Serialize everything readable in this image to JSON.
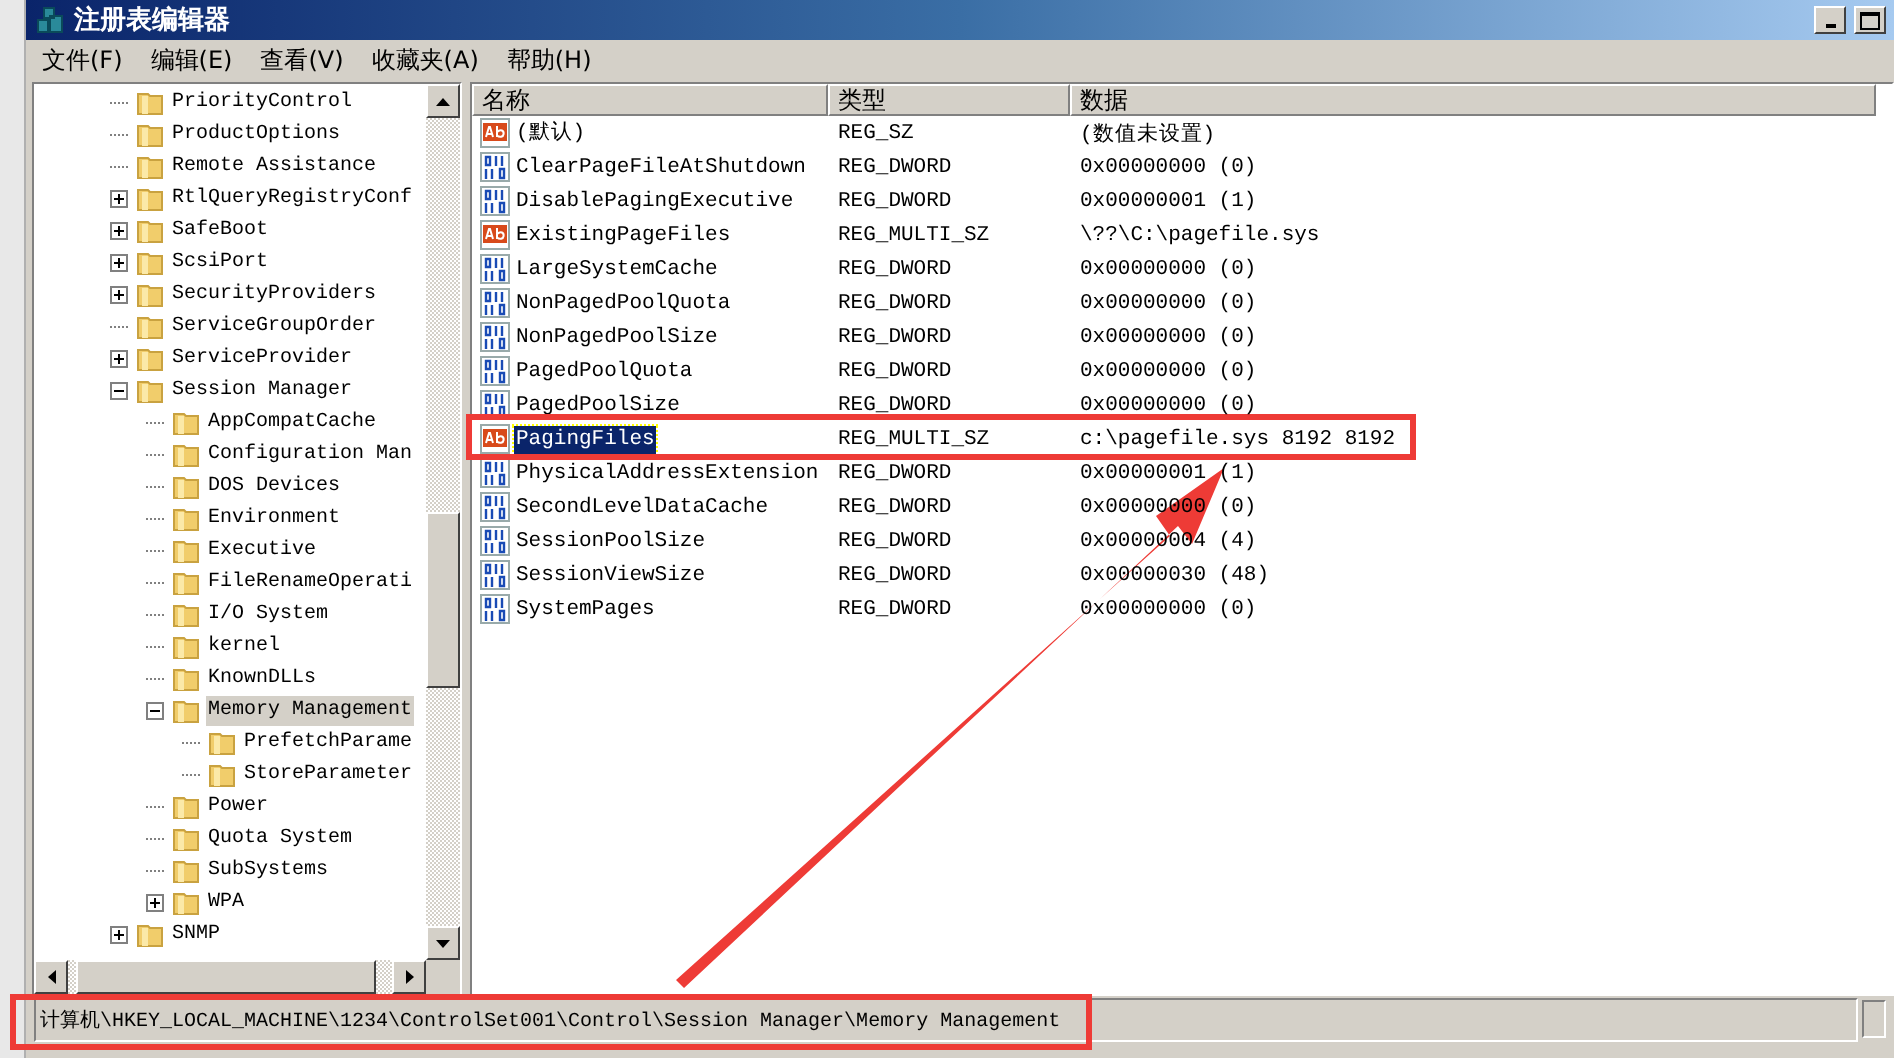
{
  "window": {
    "title": "注册表编辑器"
  },
  "menu": [
    "文件(F)",
    "编辑(E)",
    "查看(V)",
    "收藏夹(A)",
    "帮助(H)"
  ],
  "tree": [
    {
      "label": "PriorityControl",
      "has_children": false,
      "selected": false
    },
    {
      "label": "ProductOptions",
      "has_children": false,
      "selected": false
    },
    {
      "label": "Remote Assistance",
      "has_children": false,
      "selected": false
    },
    {
      "label": "RtlQueryRegistryConf",
      "has_children": true,
      "expanded": false,
      "selected": false
    },
    {
      "label": "SafeBoot",
      "has_children": true,
      "expanded": false,
      "selected": false
    },
    {
      "label": "ScsiPort",
      "has_children": true,
      "expanded": false,
      "selected": false
    },
    {
      "label": "SecurityProviders",
      "has_children": true,
      "expanded": false,
      "selected": false
    },
    {
      "label": "ServiceGroupOrder",
      "has_children": false,
      "selected": false
    },
    {
      "label": "ServiceProvider",
      "has_children": true,
      "expanded": false,
      "selected": false
    },
    {
      "label": "Session Manager",
      "has_children": true,
      "expanded": true,
      "selected": false,
      "children": [
        {
          "label": "AppCompatCache",
          "has_children": false,
          "selected": false
        },
        {
          "label": "Configuration Man",
          "has_children": false,
          "selected": false
        },
        {
          "label": "DOS Devices",
          "has_children": false,
          "selected": false
        },
        {
          "label": "Environment",
          "has_children": false,
          "selected": false
        },
        {
          "label": "Executive",
          "has_children": false,
          "selected": false
        },
        {
          "label": "FileRenameOperati",
          "has_children": false,
          "selected": false
        },
        {
          "label": "I/O System",
          "has_children": false,
          "selected": false
        },
        {
          "label": "kernel",
          "has_children": false,
          "selected": false
        },
        {
          "label": "KnownDLLs",
          "has_children": false,
          "selected": false
        },
        {
          "label": "Memory Management",
          "has_children": true,
          "expanded": true,
          "selected": true,
          "children": [
            {
              "label": "PrefetchParame",
              "has_children": false,
              "selected": false
            },
            {
              "label": "StoreParameter",
              "has_children": false,
              "selected": false
            }
          ]
        },
        {
          "label": "Power",
          "has_children": false,
          "selected": false
        },
        {
          "label": "Quota System",
          "has_children": false,
          "selected": false
        },
        {
          "label": "SubSystems",
          "has_children": false,
          "selected": false
        },
        {
          "label": "WPA",
          "has_children": true,
          "expanded": false,
          "selected": false
        }
      ]
    },
    {
      "label": "SNMP",
      "has_children": true,
      "expanded": false,
      "selected": false
    }
  ],
  "columns": [
    "名称",
    "类型",
    "数据"
  ],
  "values": [
    {
      "kind": "string",
      "name": "(默认)",
      "type": "REG_SZ",
      "data": "(数值未设置)",
      "selected": false
    },
    {
      "kind": "binary",
      "name": "ClearPageFileAtShutdown",
      "type": "REG_DWORD",
      "data": "0x00000000 (0)",
      "selected": false
    },
    {
      "kind": "binary",
      "name": "DisablePagingExecutive",
      "type": "REG_DWORD",
      "data": "0x00000001 (1)",
      "selected": false
    },
    {
      "kind": "string",
      "name": "ExistingPageFiles",
      "type": "REG_MULTI_SZ",
      "data": "\\??\\C:\\pagefile.sys",
      "selected": false
    },
    {
      "kind": "binary",
      "name": "LargeSystemCache",
      "type": "REG_DWORD",
      "data": "0x00000000 (0)",
      "selected": false
    },
    {
      "kind": "binary",
      "name": "NonPagedPoolQuota",
      "type": "REG_DWORD",
      "data": "0x00000000 (0)",
      "selected": false
    },
    {
      "kind": "binary",
      "name": "NonPagedPoolSize",
      "type": "REG_DWORD",
      "data": "0x00000000 (0)",
      "selected": false
    },
    {
      "kind": "binary",
      "name": "PagedPoolQuota",
      "type": "REG_DWORD",
      "data": "0x00000000 (0)",
      "selected": false
    },
    {
      "kind": "binary",
      "name": "PagedPoolSize",
      "type": "REG_DWORD",
      "data": "0x00000000 (0)",
      "selected": false
    },
    {
      "kind": "string",
      "name": "PagingFiles",
      "type": "REG_MULTI_SZ",
      "data": "c:\\pagefile.sys 8192 8192",
      "selected": true
    },
    {
      "kind": "binary",
      "name": "PhysicalAddressExtension",
      "type": "REG_DWORD",
      "data": "0x00000001 (1)",
      "selected": false
    },
    {
      "kind": "binary",
      "name": "SecondLevelDataCache",
      "type": "REG_DWORD",
      "data": "0x00000000 (0)",
      "selected": false
    },
    {
      "kind": "binary",
      "name": "SessionPoolSize",
      "type": "REG_DWORD",
      "data": "0x00000004 (4)",
      "selected": false
    },
    {
      "kind": "binary",
      "name": "SessionViewSize",
      "type": "REG_DWORD",
      "data": "0x00000030 (48)",
      "selected": false
    },
    {
      "kind": "binary",
      "name": "SystemPages",
      "type": "REG_DWORD",
      "data": "0x00000000 (0)",
      "selected": false
    }
  ],
  "status_bar": "计算机\\HKEY_LOCAL_MACHINE\\1234\\ControlSet001\\Control\\Session Manager\\Memory Management"
}
